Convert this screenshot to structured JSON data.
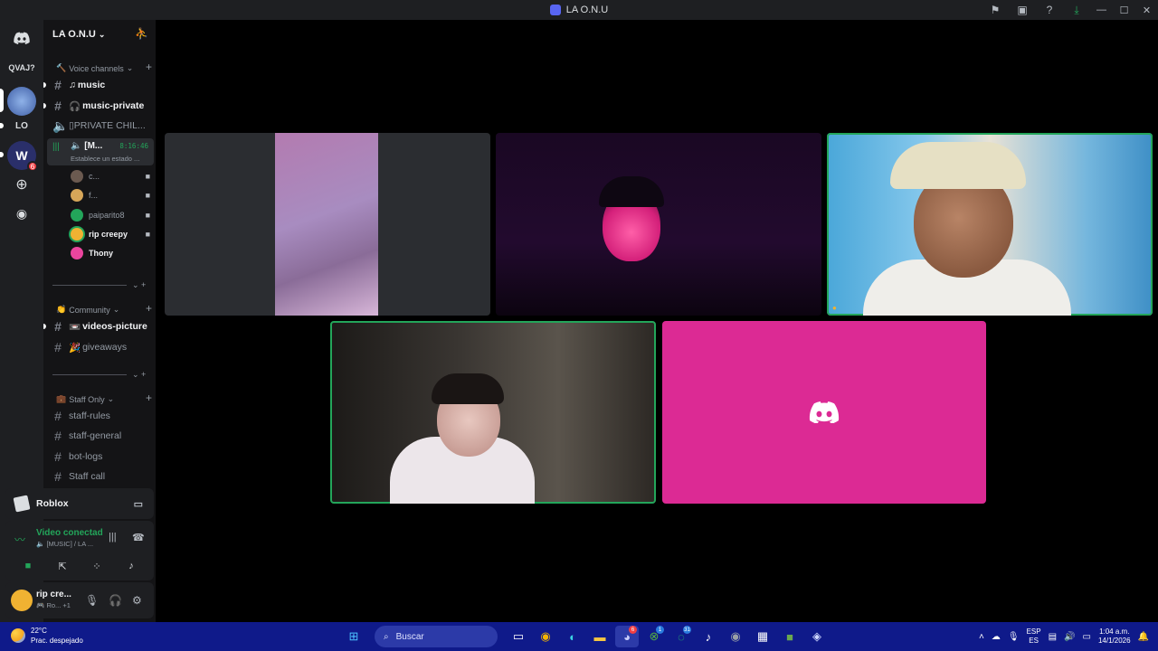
{
  "window": {
    "title": "LA O.N.U",
    "controls": [
      "—",
      "☐",
      "✕"
    ]
  },
  "rail": {
    "dms_icon": "discord-icon",
    "folder_label": "QVAJ?",
    "server_lo": "LO",
    "server_badge": "6"
  },
  "server": {
    "name": "LA O.N.U",
    "chevron": "⌄"
  },
  "categories": {
    "voice": "Voice channels",
    "community": "Community",
    "staff": "Staff Only"
  },
  "channels": {
    "music": "music",
    "music_private": "music-private",
    "private_chill": "▯PRIVATE CHIL...",
    "active_voice": "[M...",
    "active_time": "8:16:46",
    "active_status": "Establece un estado ...",
    "videos_picture": "videos-picture",
    "giveaways": "giveaways",
    "staff_rules": "staff-rules",
    "staff_general": "staff-general",
    "bot_logs": "bot-logs",
    "staff_call": "Staff call"
  },
  "voice_users": [
    {
      "name": "c...",
      "camera": true
    },
    {
      "name": "f...",
      "camera": true
    },
    {
      "name": "paiparito8",
      "camera": true
    },
    {
      "name": "rip creepy",
      "camera": true
    },
    {
      "name": "Thony",
      "camera": false
    }
  ],
  "activity": {
    "game": "Roblox"
  },
  "voice_panel": {
    "title": "Video conectado",
    "subtitle": "[MUSIC] / LA ..."
  },
  "user": {
    "name": "rip cre...",
    "status": "Ro...",
    "extra": "+1"
  },
  "taskbar": {
    "temp": "22°C",
    "weather": "Prac. despejado",
    "search": "Buscar",
    "lang_top": "ESP",
    "lang_bottom": "ES",
    "time": "1:04 a.m.",
    "date": "14/1/2026",
    "discord_badge": "6",
    "xbox_badge": "1",
    "whatsapp_badge": "31"
  },
  "colors": {
    "green": "#23a55a",
    "pink_tile": "#dc2a94",
    "blurple": "#5865f2",
    "taskbar": "#0f1a8a"
  }
}
